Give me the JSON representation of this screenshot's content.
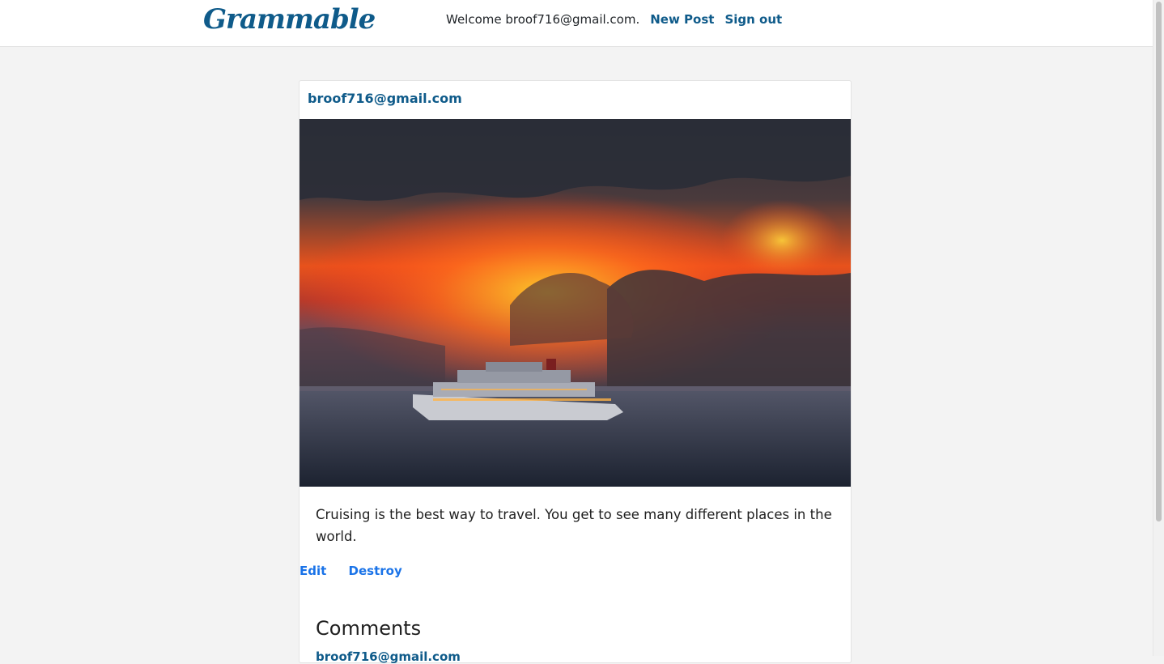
{
  "navbar": {
    "brand": "Grammable",
    "welcome_text": "Welcome broof716@gmail.com.",
    "links": {
      "new_post": "New Post",
      "sign_out": "Sign out"
    },
    "brand_color": "#0f5b8a"
  },
  "post": {
    "author": "broof716@gmail.com",
    "image": {
      "description": "cruise-ship-at-sunset",
      "sky_colors": [
        "#2f3440",
        "#ff4a1c",
        "#ffb21f"
      ],
      "sea_color": "#2a3140"
    },
    "caption": "Cruising is the best way to travel. You get to see many different places in the world.",
    "actions": {
      "edit": "Edit",
      "destroy": "Destroy"
    }
  },
  "comments": {
    "title": "Comments",
    "first_comment_user": "broof716@gmail.com"
  }
}
